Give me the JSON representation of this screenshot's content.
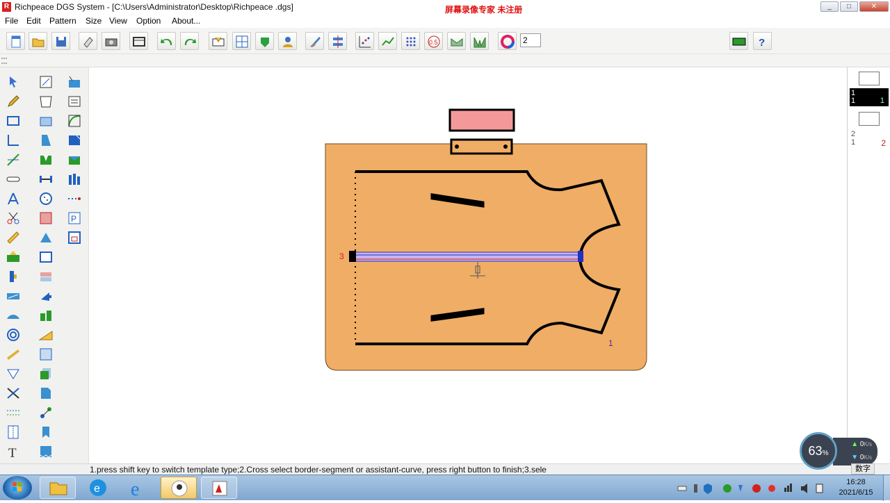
{
  "window": {
    "title": "Richpeace DGS System - [C:\\Users\\Administrator\\Desktop\\Richpeace .dgs]",
    "watermark": "屏幕录像专家  未注册",
    "controls": [
      "_",
      "□",
      "✕"
    ]
  },
  "menu": {
    "items": [
      "File",
      "Edit",
      "Pattern",
      "Size",
      "View",
      "Option",
      "About..."
    ]
  },
  "toolbar": {
    "line_width_value": "2",
    "color_swatch": "#000000"
  },
  "pieces_panel": {
    "pieces": [
      {
        "line1": "1",
        "line2": "1",
        "count": "1",
        "selected": true
      },
      {
        "line1": "2",
        "line2": "1",
        "count": "2",
        "selected": false
      }
    ]
  },
  "canvas": {
    "piece_label_left": "3",
    "piece_label_right": "1",
    "accent_fill": "#f0ad66",
    "tag_fill": "#f4999a"
  },
  "status": {
    "hint": "1.press shift key to switch template type;2.Cross select border-segment or assistant-curve, press right button to finish;3.sele"
  },
  "network_widget": {
    "percent": "63",
    "percent_unit": "%",
    "up_rate": "0",
    "down_rate": "0",
    "rate_unit": "K/s"
  },
  "taskbar": {
    "time": "16:28",
    "date": "2021/6/15",
    "ime_label": "数字"
  }
}
